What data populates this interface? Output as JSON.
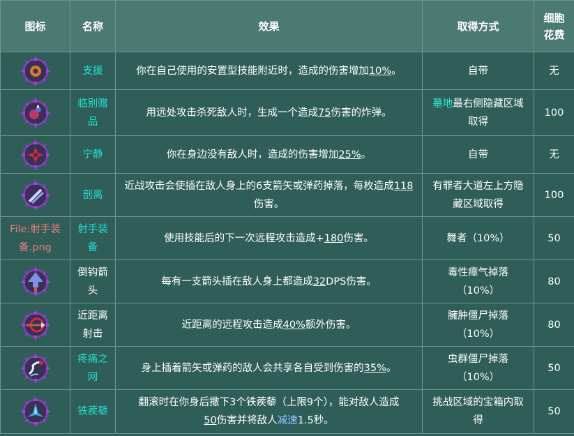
{
  "headers": {
    "icon": "图标",
    "name": "名称",
    "effect": "效果",
    "obtain": "取得方式",
    "cost_line1": "细胞",
    "cost_line2": "花费"
  },
  "rows": [
    {
      "icon": "support-icon",
      "name": "支援",
      "effect_a": "你在自己使用的安置型技能附近时，造成的伤害增加",
      "effect_num": "10%",
      "effect_b": "。",
      "obtain": "自带",
      "cost": "无"
    },
    {
      "icon": "farewell-gift-icon",
      "name_1": "临别赠",
      "name_2": "品",
      "effect_a": "用远处攻击杀死敌人时，生成一个造成",
      "effect_num": "75",
      "effect_b": "伤害的炸弹。",
      "obtain_link": "墓地",
      "obtain_a": "最右侧隐藏区域",
      "obtain_b": "取得",
      "cost": "100"
    },
    {
      "icon": "tranquility-icon",
      "name": "宁静",
      "effect_a": "你在身边没有敌人时，造成的伤害增加",
      "effect_num": "25%",
      "effect_b": "。",
      "obtain": "自带",
      "cost": "无"
    },
    {
      "icon": "dislocation-icon",
      "name": "剖离",
      "effect_a": "近战攻击会使插在敌人身上的6支箭矢或弹药掉落，每枚造成",
      "effect_num": "118",
      "effect_b": "伤害。",
      "obtain_1": "有罪者大道左上方隐",
      "obtain_2": "藏区域取得",
      "cost": "100"
    },
    {
      "icon_text_1": "File:射手装",
      "icon_text_2": "备.png",
      "name_1": "射手装",
      "name_2": "备",
      "effect_a": "使用技能后的下一次远程攻击造成+",
      "effect_num": "180",
      "effect_b": "伤害。",
      "obtain": "舞者（10%）",
      "cost": "50"
    },
    {
      "icon": "barbed-arrow-icon",
      "name_1": "倒钩箭",
      "name_2": "头",
      "effect_a": "每有一支箭头插在敌人身上都造成",
      "effect_num": "32",
      "effect_b": "DPS伤害。",
      "obtain_1": "毒性瘴气掉落",
      "obtain_2": "（10%）",
      "cost": "80"
    },
    {
      "icon": "point-blank-icon",
      "name_1": "近距离",
      "name_2": "射击",
      "effect_a": "近距离的远程攻击造成",
      "effect_num": "40%",
      "effect_b": "额外伤害。",
      "obtain_1": "臃肿僵尸掉落",
      "obtain_2": "（10%）",
      "cost": "80"
    },
    {
      "icon": "web-of-pain-icon",
      "name_1": "疼痛之",
      "name_2": "网",
      "effect_a": "身上插着箭矢或弹药的敌人会共享各自受到伤害的",
      "effect_num": "35%",
      "effect_b": "。",
      "obtain_1": "虫群僵尸掉落",
      "obtain_2": "（10%）",
      "cost": "50"
    },
    {
      "icon": "caltrops-icon",
      "name": "铁蒺藜",
      "effect_line1": "翻滚时在你身后撒下3个铁蒺藜（上限9个），能对敌人造成",
      "effect_num": "50",
      "effect_mid": "伤害并将敌人",
      "effect_link": "减速",
      "effect_end": "1.5秒。",
      "obtain_1": "挑战区域的宝箱内取",
      "obtain_2": "得",
      "cost": "50"
    }
  ],
  "colors": {
    "header_bg": "#4b7a73",
    "cell_bg": "#2f5e58",
    "name_cyan": "#22ddd4",
    "missing_file_red": "#e97c7c",
    "link_blue": "#8cc7ff"
  }
}
